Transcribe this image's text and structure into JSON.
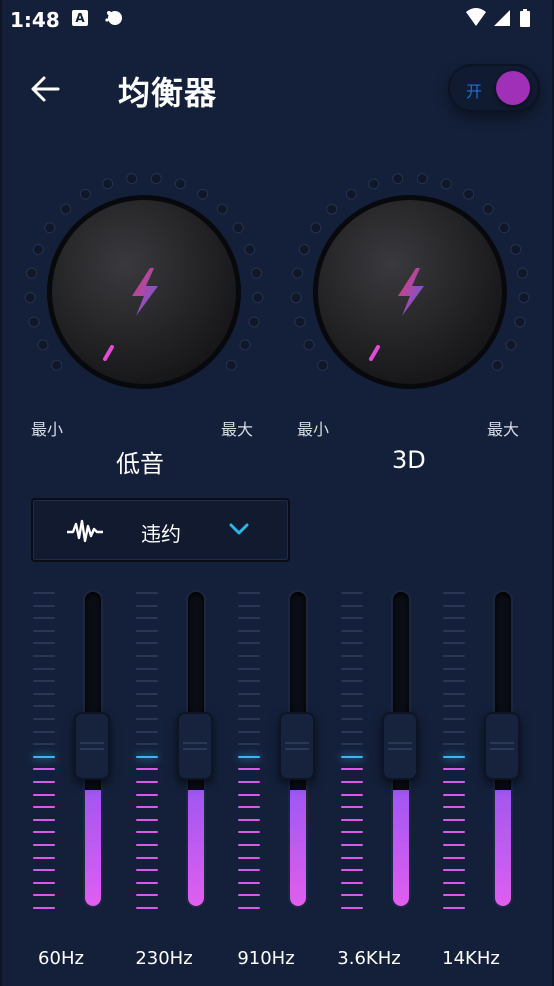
{
  "status_bar": {
    "time": "1:48",
    "notif_a": "A"
  },
  "header": {
    "title": "均衡器",
    "power_label": "开"
  },
  "knobs": [
    {
      "name": "低音",
      "min_label": "最小",
      "max_label": "最大"
    },
    {
      "name": "3D",
      "min_label": "最小",
      "max_label": "最大"
    }
  ],
  "preset": {
    "name": "违约"
  },
  "bands": [
    {
      "label": "60Hz",
      "level": 0.5
    },
    {
      "label": "230Hz",
      "level": 0.5
    },
    {
      "label": "910Hz",
      "level": 0.5
    },
    {
      "label": "3.6KHz",
      "level": 0.5
    },
    {
      "label": "14KHz",
      "level": 0.5
    }
  ],
  "colors": {
    "background": "#14203a",
    "accent": "#a030b8",
    "fill_top": "#a057f0",
    "fill_bottom": "#e05ff0",
    "tick_active": "#3bb6f0",
    "tick_pink": "#d85be8"
  }
}
